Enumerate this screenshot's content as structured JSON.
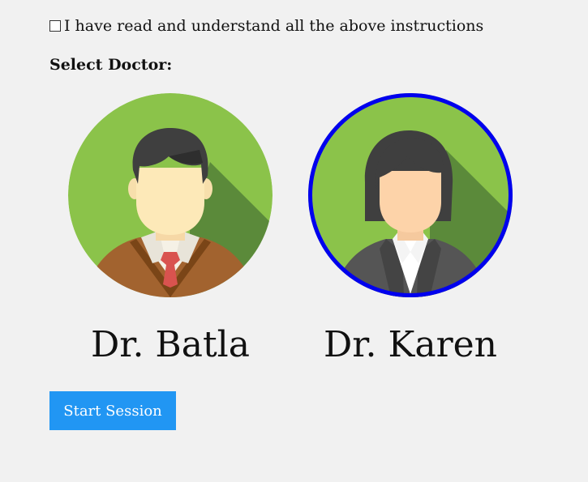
{
  "agreement": {
    "checked": false,
    "label": "I have read and understand all the above instructions"
  },
  "select_doctor": {
    "label": "Select Doctor:"
  },
  "doctors": [
    {
      "name": "Dr. Batla",
      "selected": false,
      "avatar_icon": "male-doctor-avatar-icon"
    },
    {
      "name": "Dr. Karen",
      "selected": true,
      "avatar_icon": "female-doctor-avatar-icon"
    }
  ],
  "start_button": {
    "label": "Start Session"
  },
  "colors": {
    "background": "#f1f1f1",
    "avatar_green": "#8bc34a",
    "avatar_shadow": "#5b8a3a",
    "selection_ring": "#0000ee",
    "button_bg": "#2196f3",
    "button_text": "#ffffff"
  }
}
